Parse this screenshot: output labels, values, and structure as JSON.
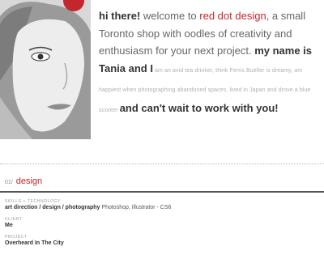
{
  "colors": {
    "accent": "#c4262e",
    "text_dark": "#333333",
    "text_muted": "#b0b0b0"
  },
  "intro": {
    "greeting": "hi there!",
    "welcome": " welcome to ",
    "brand": "red dot design",
    "tagline": ", a small Toronto shop with oodles of creativity and enthusiasm for your next project. ",
    "name_line": "my name is Tania and I",
    "about": " am an avid tea drinker,  think Ferris Bueller is dreamy,  am happiest when photographing abandoned spaces,  lived in Japan and drove a blue scooter ",
    "closing": "and can't wait to work with you!"
  },
  "section": {
    "number": "01/",
    "title": "design"
  },
  "details": {
    "skills_label": "SKILLS + TECHNOLOGY",
    "skills_value": "art direction / design / photography",
    "skills_tools": " Photoshop, Illustrator - CS6",
    "client_label": "CLIENT",
    "client_value": "Me",
    "project_label": "PROJECT",
    "project_value": "Overheard In The City"
  }
}
